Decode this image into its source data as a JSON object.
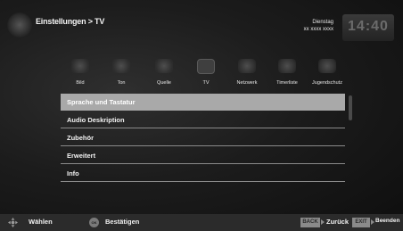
{
  "header": {
    "breadcrumb": "Einstellungen > TV",
    "day": "Dienstag",
    "date": "xx xxxx xxxx",
    "clock": "14:40"
  },
  "categories": [
    {
      "label": "Bild",
      "icon": "picture-icon"
    },
    {
      "label": "Ton",
      "icon": "sound-icon"
    },
    {
      "label": "Quelle",
      "icon": "source-icon"
    },
    {
      "label": "TV",
      "icon": "tv-icon",
      "active": true
    },
    {
      "label": "Netzwerk",
      "icon": "network-icon"
    },
    {
      "label": "Timerliste",
      "icon": "timer-icon"
    },
    {
      "label": "Jugendschutz",
      "icon": "parental-lock-icon"
    }
  ],
  "menu": {
    "items": [
      {
        "label": "Sprache und Tastatur",
        "selected": true
      },
      {
        "label": "Audio Deskription"
      },
      {
        "label": "Zubehör"
      },
      {
        "label": "Erweitert"
      },
      {
        "label": "Info"
      }
    ]
  },
  "footer": {
    "select_label": "Wählen",
    "ok_key": "OK",
    "confirm_label": "Bestätigen",
    "back_key": "BACK",
    "back_label": "Zurück",
    "exit_key": "EXIT",
    "exit_label": "Beenden"
  },
  "colors": {
    "selected_row": "#a9a9a9",
    "divider": "#8a8a8a",
    "footer_bg": "#2b2b2b"
  }
}
